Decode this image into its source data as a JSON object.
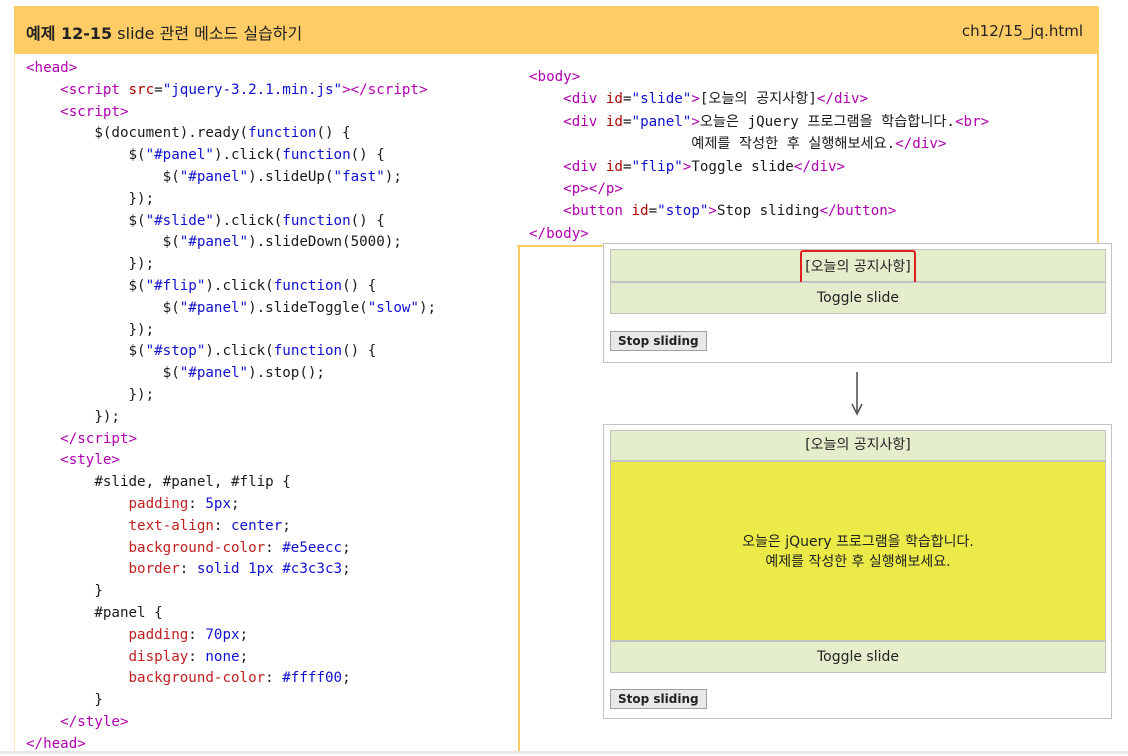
{
  "header": {
    "label": "예제 12-15",
    "title": "slide 관련 메소드 실습하기",
    "filename": "ch12/15_jq.html"
  },
  "head_code": {
    "script_src": "jquery-3.2.1.min.js",
    "panel_click_speed": "fast",
    "slide_click_duration": "5000",
    "flip_click_speed": "slow",
    "css_padding": "5px",
    "css_text_align": "center",
    "css_bg": "#e5eecc",
    "css_border": "solid 1px #c3c3c3",
    "panel_padding": "70px",
    "panel_display": "none",
    "panel_bg": "#ffff00"
  },
  "body_code": {
    "slide_text": "[오늘의 공지사항]",
    "panel_text_1": "오늘은 jQuery 프로그램을 학습합니다.",
    "panel_text_2": "예제를 작성한 후 실행해보세요.",
    "flip_text": "Toggle slide",
    "stop_text": "Stop sliding"
  },
  "demo_before": {
    "slide": "[오늘의 공지사항]",
    "flip": "Toggle slide",
    "button": "Stop sliding"
  },
  "demo_after": {
    "slide": "[오늘의 공지사항]",
    "panel_line1": "오늘은 jQuery 프로그램을 학습합니다.",
    "panel_line2": "예제를 작성한 후 실행해보세요.",
    "flip": "Toggle slide",
    "button": "Stop sliding"
  },
  "colors": {
    "header": "#ffcc66",
    "slide_bg": "#e5eecc",
    "panel_bg": "#ebea48",
    "highlight": "#e02020"
  }
}
